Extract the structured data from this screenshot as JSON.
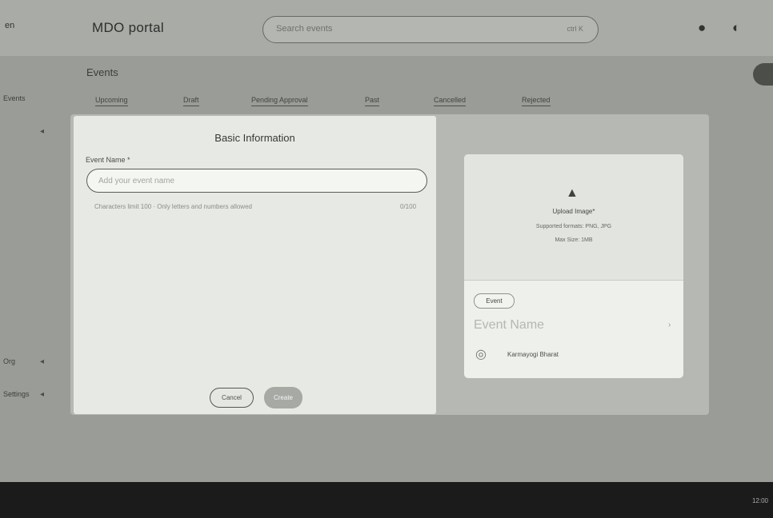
{
  "app": {
    "title": "MDO portal",
    "left_edge_text": "en",
    "search_placeholder": "Search events",
    "search_hint": "ctrl K",
    "icons": [
      "bell-icon",
      "profile-icon"
    ]
  },
  "page": {
    "title": "Events",
    "side_labels": [
      "Events",
      "Org",
      "Settings"
    ],
    "tabs": [
      "Upcoming",
      "Draft",
      "Pending Approval",
      "Past",
      "Cancelled",
      "Rejected"
    ]
  },
  "modal": {
    "title": "Basic Information",
    "field_label": "Event Name *",
    "input_placeholder": "Add your event name",
    "input_value": "",
    "helper_text": "Characters limit 100 · Only letters and numbers allowed",
    "char_count": "0/100",
    "cancel_label": "Cancel",
    "primary_label": "Create"
  },
  "preview": {
    "upload_title": "Upload Image*",
    "upload_formats": "Supported formats: PNG, JPG",
    "upload_size": "Max Size: 1MB",
    "event_type": "Event",
    "event_name_placeholder": "Event Name",
    "community_label": "Karmayogi Bharat"
  },
  "taskbar": {
    "clock": "12:00"
  },
  "colors": {
    "background": "#9a9c98",
    "modal": "#e7e9e5",
    "taskbar": "#1b1b1b"
  }
}
